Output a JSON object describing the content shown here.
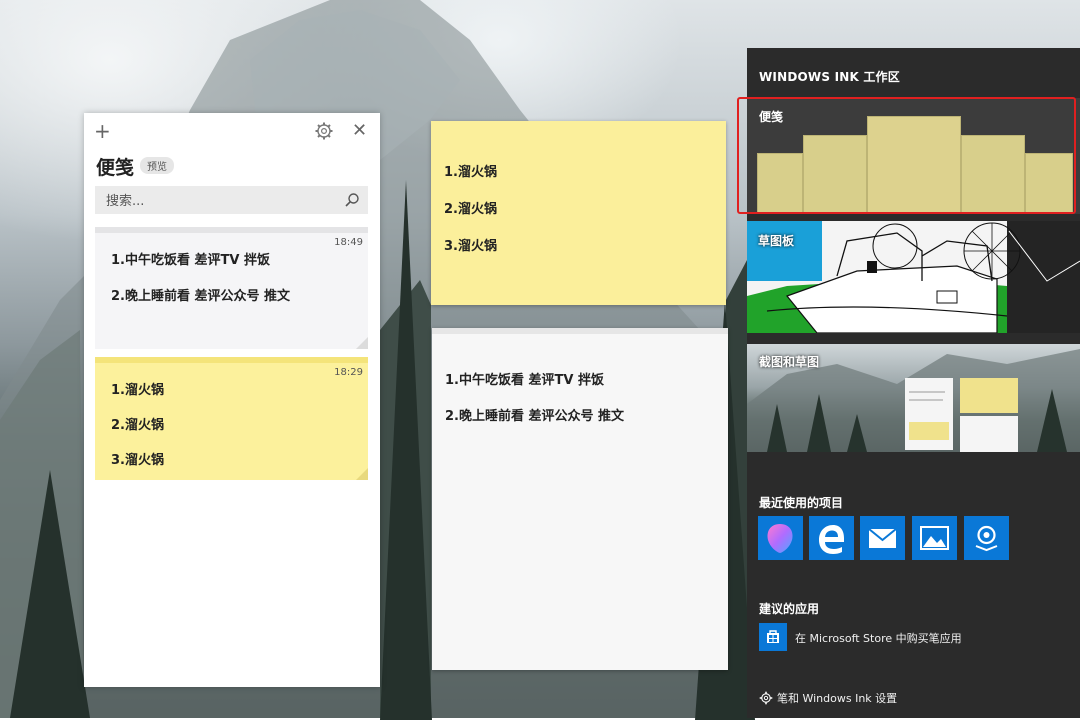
{
  "sticky_notes": {
    "title": "便笺",
    "badge": "预览",
    "search_placeholder": "搜索...",
    "notes": [
      {
        "time": "18:49",
        "lines": [
          "1.中午吃饭看 差评TV 拌饭",
          "2.晚上睡前看 差评公众号 推文"
        ],
        "color": "#f5f5f7"
      },
      {
        "time": "18:29",
        "lines": [
          "1.溜火锅",
          "2.溜火锅",
          "3.溜火锅"
        ],
        "color": "#fcf19c"
      }
    ]
  },
  "yellow_note": {
    "lines": [
      "1.溜火锅",
      "2.溜火锅",
      "3.溜火锅"
    ],
    "color": "#fbef9b"
  },
  "white_note": {
    "lines": [
      "1.中午吃饭看 差评TV 拌饭",
      "2.晚上睡前看 差评公众号 推文"
    ]
  },
  "ink_workspace": {
    "title": "WINDOWS INK 工作区",
    "tiles": {
      "sticky_notes": "便笺",
      "sketchpad": "草图板",
      "screen_sketch": "截图和草图"
    },
    "recent_label": "最近使用的项目",
    "recent_apps": [
      "paint3d-icon",
      "edge-icon",
      "mail-icon",
      "photos-icon",
      "maps-icon"
    ],
    "suggested_label": "建议的应用",
    "store_text": "在 Microsoft Store 中购买笔应用",
    "settings_text": "笔和 Windows Ink 设置",
    "accent": "#0a78d7",
    "highlight": "#e02020"
  }
}
